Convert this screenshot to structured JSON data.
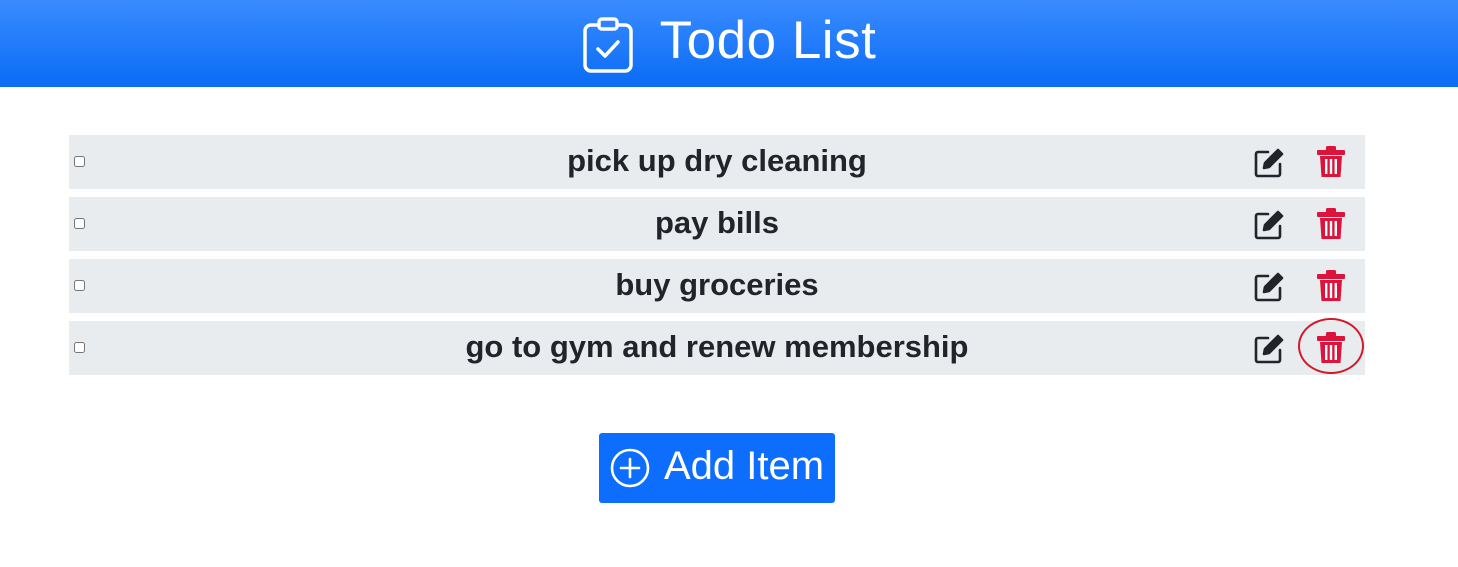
{
  "app": {
    "title": "Todo List",
    "header_icon": "clipboard-check-icon",
    "accent_color": "#0d6efd"
  },
  "todos": [
    {
      "text": "pick up dry cleaning",
      "checked": false
    },
    {
      "text": "pay bills",
      "checked": false
    },
    {
      "text": "buy groceries",
      "checked": false
    },
    {
      "text": "go to gym and renew membership",
      "checked": false,
      "highlighted_action": "delete"
    }
  ],
  "row_actions": {
    "edit_icon": "pencil-square-icon",
    "delete_icon": "trash-icon",
    "delete_color": "#dc143c"
  },
  "add_button": {
    "label": "Add Item",
    "icon": "plus-circle-icon"
  }
}
